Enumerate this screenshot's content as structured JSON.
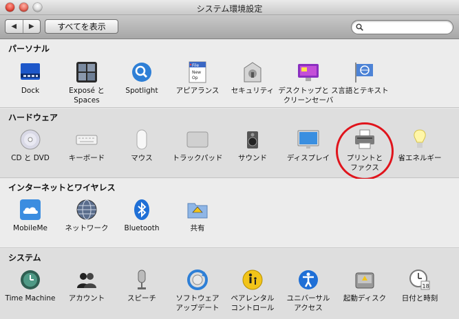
{
  "window": {
    "title": "システム環境設定"
  },
  "toolbar": {
    "back": "◀",
    "forward": "▶",
    "show_all": "すべてを表示",
    "search_value": "",
    "search_placeholder": ""
  },
  "sections": {
    "personal": {
      "title": "パーソナル",
      "items": [
        {
          "label": "Dock",
          "icon": "dock-icon"
        },
        {
          "label": "Exposé と Spaces",
          "icon": "expose-spaces-icon"
        },
        {
          "label": "Spotlight",
          "icon": "spotlight-icon"
        },
        {
          "label": "アピアランス",
          "icon": "appearance-icon"
        },
        {
          "label": "セキュリティ",
          "icon": "security-icon"
        },
        {
          "label": "デスクトップと スクリーンセーバ",
          "icon": "desktop-screensaver-icon"
        },
        {
          "label": "言語とテキスト",
          "icon": "language-text-icon"
        }
      ]
    },
    "hardware": {
      "title": "ハードウェア",
      "items": [
        {
          "label": "CD と DVD",
          "icon": "cd-dvd-icon"
        },
        {
          "label": "キーボード",
          "icon": "keyboard-icon"
        },
        {
          "label": "マウス",
          "icon": "mouse-icon"
        },
        {
          "label": "トラックパッド",
          "icon": "trackpad-icon"
        },
        {
          "label": "サウンド",
          "icon": "sound-icon"
        },
        {
          "label": "ディスプレイ",
          "icon": "display-icon"
        },
        {
          "label": "プリントと ファクス",
          "icon": "printer-icon"
        },
        {
          "label": "省エネルギー",
          "icon": "energy-saver-icon"
        }
      ]
    },
    "internet": {
      "title": "インターネットとワイヤレス",
      "items": [
        {
          "label": "MobileMe",
          "icon": "mobileme-icon"
        },
        {
          "label": "ネットワーク",
          "icon": "network-icon"
        },
        {
          "label": "Bluetooth",
          "icon": "bluetooth-icon"
        },
        {
          "label": "共有",
          "icon": "sharing-icon"
        }
      ]
    },
    "system": {
      "title": "システム",
      "items": [
        {
          "label": "Time Machine",
          "icon": "time-machine-icon"
        },
        {
          "label": "アカウント",
          "icon": "accounts-icon"
        },
        {
          "label": "スピーチ",
          "icon": "speech-icon"
        },
        {
          "label": "ソフトウェア アップデート",
          "icon": "software-update-icon"
        },
        {
          "label": "ペアレンタル コントロール",
          "icon": "parental-controls-icon"
        },
        {
          "label": "ユニバーサル アクセス",
          "icon": "universal-access-icon"
        },
        {
          "label": "起動ディスク",
          "icon": "startup-disk-icon"
        },
        {
          "label": "日付と時刻",
          "icon": "date-time-icon"
        }
      ]
    }
  },
  "icon_text": {
    "appearance_file": "File",
    "appearance_new": "New",
    "appearance_op": "Op",
    "date_day": "18"
  },
  "colors": {
    "annotation": "#e0141c",
    "accent_blue": "#2e7fd6"
  }
}
